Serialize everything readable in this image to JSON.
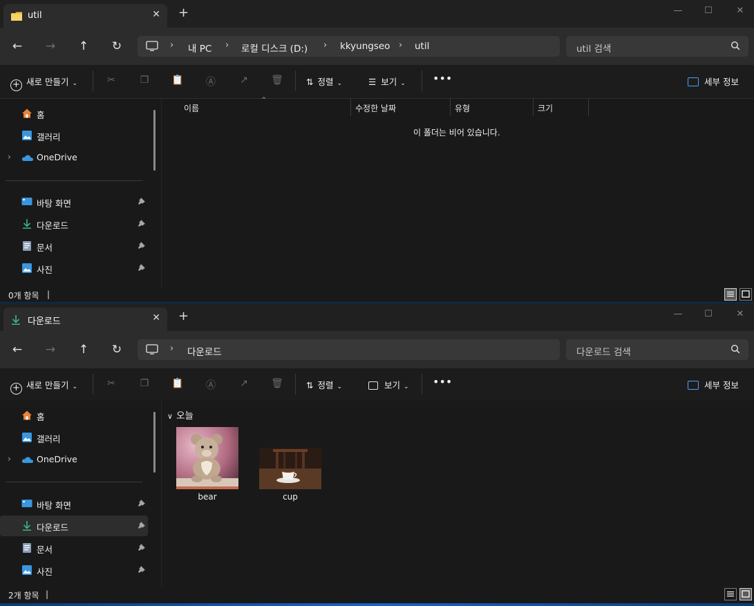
{
  "colors": {
    "accent": "#0078d4",
    "folder_yellow": "#f0c24a",
    "download_green": "#3bb58a",
    "onedrive_blue": "#3a96dd",
    "home_orange": "#e8833a"
  },
  "window1": {
    "tab_title": "util",
    "tab_icon": "folder-icon",
    "breadcrumb": [
      "내 PC",
      "로컬 디스크 (D:)",
      "kkyungseo",
      "util"
    ],
    "search_placeholder": "util 검색",
    "toolbar": {
      "new_label": "새로 만들기",
      "sort_label": "정렬",
      "view_label": "보기",
      "details_label": "세부 정보"
    },
    "sidebar": {
      "top_items": [
        {
          "label": "홈",
          "icon": "home-icon"
        },
        {
          "label": "갤러리",
          "icon": "gallery-icon"
        },
        {
          "label": "OneDrive",
          "icon": "onedrive-icon"
        }
      ],
      "pinned_items": [
        {
          "label": "바탕 화면",
          "icon": "desktop-icon"
        },
        {
          "label": "다운로드",
          "icon": "download-icon"
        },
        {
          "label": "문서",
          "icon": "documents-icon"
        },
        {
          "label": "사진",
          "icon": "pictures-icon"
        }
      ]
    },
    "columns": [
      "이름",
      "수정한 날짜",
      "유형",
      "크기"
    ],
    "empty_message": "이 폴더는 비어 있습니다.",
    "status": "0개 항목"
  },
  "window2": {
    "tab_title": "다운로드",
    "tab_icon": "download-icon",
    "breadcrumb": [
      "다운로드"
    ],
    "search_placeholder": "다운로드 검색",
    "toolbar": {
      "new_label": "새로 만들기",
      "sort_label": "정렬",
      "view_label": "보기",
      "details_label": "세부 정보"
    },
    "sidebar": {
      "top_items": [
        {
          "label": "홈",
          "icon": "home-icon"
        },
        {
          "label": "갤러리",
          "icon": "gallery-icon"
        },
        {
          "label": "OneDrive",
          "icon": "onedrive-icon"
        }
      ],
      "pinned_items": [
        {
          "label": "바탕 화면",
          "icon": "desktop-icon"
        },
        {
          "label": "다운로드",
          "icon": "download-icon"
        },
        {
          "label": "문서",
          "icon": "documents-icon"
        },
        {
          "label": "사진",
          "icon": "pictures-icon"
        }
      ]
    },
    "group_header": "오늘",
    "files": [
      {
        "name": "bear",
        "kind": "image"
      },
      {
        "name": "cup",
        "kind": "image"
      }
    ],
    "status": "2개 항목"
  }
}
